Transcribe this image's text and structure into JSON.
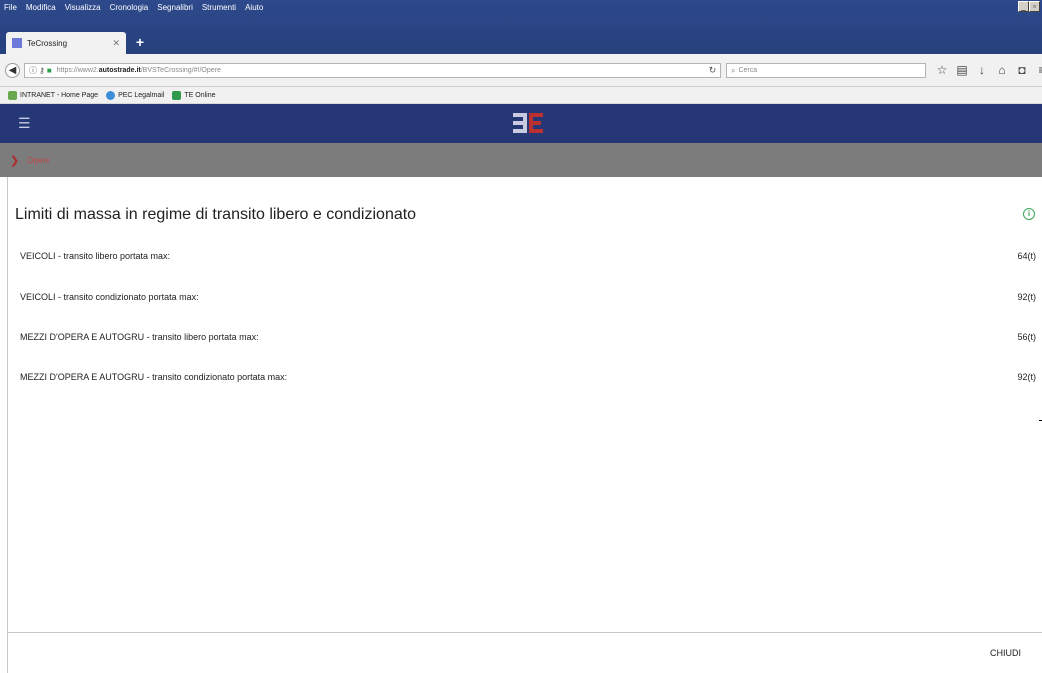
{
  "browser": {
    "menu": [
      "File",
      "Modifica",
      "Visualizza",
      "Cronologia",
      "Segnalibri",
      "Strumenti",
      "Aiuto"
    ],
    "tab_title": "TeCrossing",
    "url_prefix": "https://www2.",
    "url_domain": "autostrade.it",
    "url_suffix": "/BVSTeCrossing/#!/Opere",
    "search_placeholder": "Cerca",
    "bookmarks": [
      "INTRANET - Home Page",
      "PEC Legalmail",
      "TE Online"
    ]
  },
  "colors": {
    "app_header": "#253776",
    "breadcrumb_bar": "#7c7c7c",
    "accent_green": "#3aa75b"
  },
  "breadcrumb": {
    "label": "Opere"
  },
  "content": {
    "title": "Limiti di massa in regime di transito libero e condizionato",
    "rows": [
      {
        "label": "VEICOLI - transito libero portata max:",
        "value": "64(t)"
      },
      {
        "label": "VEICOLI - transito condizionato portata max:",
        "value": "92(t)"
      },
      {
        "label": "MEZZI D'OPERA E AUTOGRU - transito libero portata max:",
        "value": "56(t)"
      },
      {
        "label": "MEZZI D'OPERA E AUTOGRU - transito condizionato portata max:",
        "value": "92(t)"
      }
    ]
  },
  "footer": {
    "close_label": "CHIUDI"
  }
}
